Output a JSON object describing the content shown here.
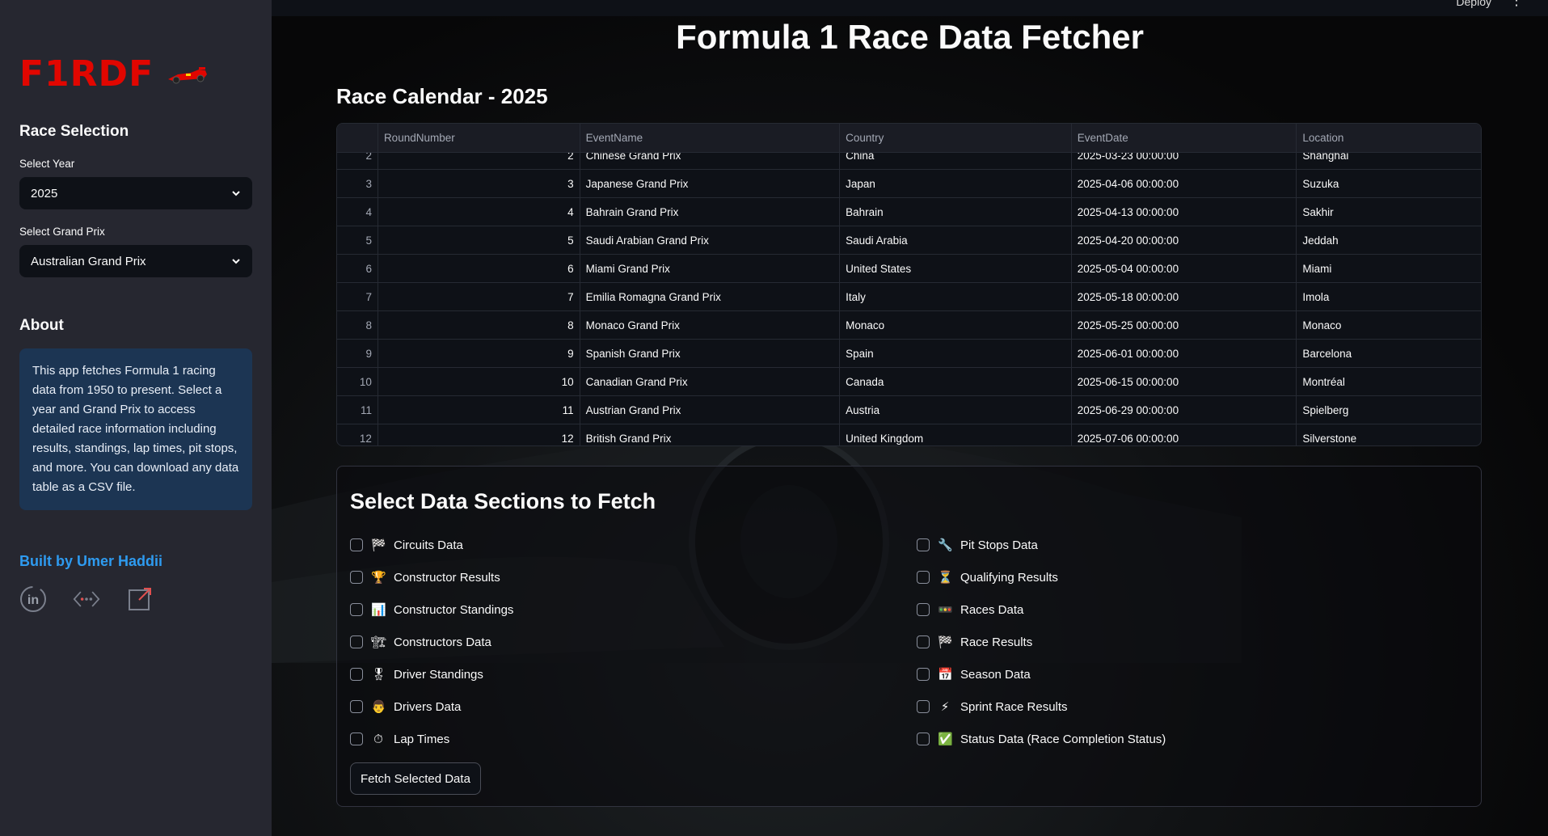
{
  "sidebar": {
    "logo": "F1RDF",
    "race_selection_heading": "Race Selection",
    "year_label": "Select Year",
    "year_value": "2025",
    "gp_label": "Select Grand Prix",
    "gp_value": "Australian Grand Prix",
    "about_heading": "About",
    "about_text": "This app fetches Formula 1 racing data from 1950 to present. Select a year and Grand Prix to access detailed race information including results, standings, lap times, pit stops, and more. You can download any data table as a CSV file.",
    "built_by": "Built by Umer Haddii",
    "social_icons": [
      "linkedin-icon",
      "code-icon",
      "external-link-icon"
    ]
  },
  "topbar": {
    "deploy": "Deploy",
    "menu": "⋮"
  },
  "main": {
    "title": "Formula 1 Race Data Fetcher",
    "calendar_title": "Race Calendar - 2025"
  },
  "table": {
    "columns": [
      "",
      "RoundNumber",
      "EventName",
      "Country",
      "EventDate",
      "Location"
    ],
    "rows": [
      [
        "2",
        "2",
        "Chinese Grand Prix",
        "China",
        "2025-03-23 00:00:00",
        "Shanghai"
      ],
      [
        "3",
        "3",
        "Japanese Grand Prix",
        "Japan",
        "2025-04-06 00:00:00",
        "Suzuka"
      ],
      [
        "4",
        "4",
        "Bahrain Grand Prix",
        "Bahrain",
        "2025-04-13 00:00:00",
        "Sakhir"
      ],
      [
        "5",
        "5",
        "Saudi Arabian Grand Prix",
        "Saudi Arabia",
        "2025-04-20 00:00:00",
        "Jeddah"
      ],
      [
        "6",
        "6",
        "Miami Grand Prix",
        "United States",
        "2025-05-04 00:00:00",
        "Miami"
      ],
      [
        "7",
        "7",
        "Emilia Romagna Grand Prix",
        "Italy",
        "2025-05-18 00:00:00",
        "Imola"
      ],
      [
        "8",
        "8",
        "Monaco Grand Prix",
        "Monaco",
        "2025-05-25 00:00:00",
        "Monaco"
      ],
      [
        "9",
        "9",
        "Spanish Grand Prix",
        "Spain",
        "2025-06-01 00:00:00",
        "Barcelona"
      ],
      [
        "10",
        "10",
        "Canadian Grand Prix",
        "Canada",
        "2025-06-15 00:00:00",
        "Montréal"
      ],
      [
        "11",
        "11",
        "Austrian Grand Prix",
        "Austria",
        "2025-06-29 00:00:00",
        "Spielberg"
      ],
      [
        "12",
        "12",
        "British Grand Prix",
        "United Kingdom",
        "2025-07-06 00:00:00",
        "Silverstone"
      ]
    ]
  },
  "sections": {
    "title": "Select Data Sections to Fetch",
    "left": [
      {
        "emoji": "🏁",
        "label": "Circuits Data",
        "icon": "checkered-flag-icon"
      },
      {
        "emoji": "🏆",
        "label": "Constructor Results",
        "icon": "trophy-icon"
      },
      {
        "emoji": "📊",
        "label": "Constructor Standings",
        "icon": "bar-chart-icon"
      },
      {
        "emoji": "🏗",
        "label": "Constructors Data",
        "icon": "construction-icon"
      },
      {
        "emoji": "🎖",
        "label": "Driver Standings",
        "icon": "medal-icon"
      },
      {
        "emoji": "👨",
        "label": "Drivers Data",
        "icon": "driver-icon"
      },
      {
        "emoji": "⏱",
        "label": "Lap Times",
        "icon": "stopwatch-icon"
      }
    ],
    "right": [
      {
        "emoji": "🔧",
        "label": "Pit Stops Data",
        "icon": "wrench-icon"
      },
      {
        "emoji": "⏳",
        "label": "Qualifying Results",
        "icon": "hourglass-icon"
      },
      {
        "emoji": "🚥",
        "label": "Races Data",
        "icon": "traffic-light-icon"
      },
      {
        "emoji": "🏁",
        "label": "Race Results",
        "icon": "checkered-flag-icon"
      },
      {
        "emoji": "📅",
        "label": "Season Data",
        "icon": "calendar-icon"
      },
      {
        "emoji": "⚡",
        "label": "Sprint Race Results",
        "icon": "lightning-icon"
      },
      {
        "emoji": "✅",
        "label": "Status Data (Race Completion Status)",
        "icon": "check-mark-icon"
      }
    ],
    "fetch_button": "Fetch Selected Data"
  },
  "colors": {
    "logo_red": "#e10600",
    "sidebar_bg": "#262730",
    "about_bg": "#1c3553",
    "link_blue": "#2e9bf0"
  }
}
